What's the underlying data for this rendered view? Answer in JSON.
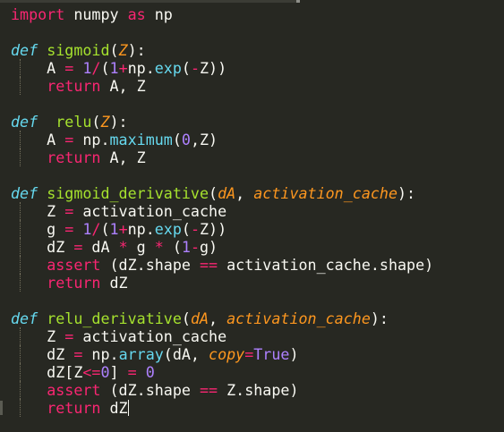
{
  "code": {
    "lines": [
      [
        {
          "t": "import",
          "c": "kw"
        },
        {
          "t": " numpy ",
          "c": "txt"
        },
        {
          "t": "as",
          "c": "kw"
        },
        {
          "t": " np",
          "c": "txt"
        }
      ],
      [],
      [
        {
          "t": "def",
          "c": "def"
        },
        {
          "t": " ",
          "c": "txt"
        },
        {
          "t": "sigmoid",
          "c": "fn"
        },
        {
          "t": "(",
          "c": "txt"
        },
        {
          "t": "Z",
          "c": "param"
        },
        {
          "t": "):",
          "c": "txt"
        }
      ],
      [
        {
          "t": "    A ",
          "c": "txt"
        },
        {
          "t": "=",
          "c": "op"
        },
        {
          "t": " ",
          "c": "txt"
        },
        {
          "t": "1",
          "c": "num"
        },
        {
          "t": "/",
          "c": "op"
        },
        {
          "t": "(",
          "c": "txt"
        },
        {
          "t": "1",
          "c": "num"
        },
        {
          "t": "+",
          "c": "op"
        },
        {
          "t": "np.",
          "c": "txt"
        },
        {
          "t": "exp",
          "c": "call"
        },
        {
          "t": "(",
          "c": "txt"
        },
        {
          "t": "-",
          "c": "op"
        },
        {
          "t": "Z))",
          "c": "txt"
        }
      ],
      [
        {
          "t": "    ",
          "c": "txt"
        },
        {
          "t": "return",
          "c": "kw"
        },
        {
          "t": " A, Z",
          "c": "txt"
        }
      ],
      [],
      [
        {
          "t": "def",
          "c": "def"
        },
        {
          "t": "  ",
          "c": "txt"
        },
        {
          "t": "relu",
          "c": "fn"
        },
        {
          "t": "(",
          "c": "txt"
        },
        {
          "t": "Z",
          "c": "param"
        },
        {
          "t": "):",
          "c": "txt"
        }
      ],
      [
        {
          "t": "    A ",
          "c": "txt"
        },
        {
          "t": "=",
          "c": "op"
        },
        {
          "t": " np.",
          "c": "txt"
        },
        {
          "t": "maximum",
          "c": "call"
        },
        {
          "t": "(",
          "c": "txt"
        },
        {
          "t": "0",
          "c": "num"
        },
        {
          "t": ",Z)",
          "c": "txt"
        }
      ],
      [
        {
          "t": "    ",
          "c": "txt"
        },
        {
          "t": "return",
          "c": "kw"
        },
        {
          "t": " A, Z",
          "c": "txt"
        }
      ],
      [],
      [
        {
          "t": "def",
          "c": "def"
        },
        {
          "t": " ",
          "c": "txt"
        },
        {
          "t": "sigmoid_derivative",
          "c": "fn"
        },
        {
          "t": "(",
          "c": "txt"
        },
        {
          "t": "dA",
          "c": "param"
        },
        {
          "t": ", ",
          "c": "txt"
        },
        {
          "t": "activation_cache",
          "c": "param"
        },
        {
          "t": "):",
          "c": "txt"
        }
      ],
      [
        {
          "t": "    Z ",
          "c": "txt"
        },
        {
          "t": "=",
          "c": "op"
        },
        {
          "t": " activation_cache",
          "c": "txt"
        }
      ],
      [
        {
          "t": "    g ",
          "c": "txt"
        },
        {
          "t": "=",
          "c": "op"
        },
        {
          "t": " ",
          "c": "txt"
        },
        {
          "t": "1",
          "c": "num"
        },
        {
          "t": "/",
          "c": "op"
        },
        {
          "t": "(",
          "c": "txt"
        },
        {
          "t": "1",
          "c": "num"
        },
        {
          "t": "+",
          "c": "op"
        },
        {
          "t": "np.",
          "c": "txt"
        },
        {
          "t": "exp",
          "c": "call"
        },
        {
          "t": "(",
          "c": "txt"
        },
        {
          "t": "-",
          "c": "op"
        },
        {
          "t": "Z))",
          "c": "txt"
        }
      ],
      [
        {
          "t": "    dZ ",
          "c": "txt"
        },
        {
          "t": "=",
          "c": "op"
        },
        {
          "t": " dA ",
          "c": "txt"
        },
        {
          "t": "*",
          "c": "op"
        },
        {
          "t": " g ",
          "c": "txt"
        },
        {
          "t": "*",
          "c": "op"
        },
        {
          "t": " (",
          "c": "txt"
        },
        {
          "t": "1",
          "c": "num"
        },
        {
          "t": "-",
          "c": "op"
        },
        {
          "t": "g)",
          "c": "txt"
        }
      ],
      [
        {
          "t": "    ",
          "c": "txt"
        },
        {
          "t": "assert",
          "c": "kw"
        },
        {
          "t": " (dZ.shape ",
          "c": "txt"
        },
        {
          "t": "==",
          "c": "op"
        },
        {
          "t": " activation_cache.shape)",
          "c": "txt"
        }
      ],
      [
        {
          "t": "    ",
          "c": "txt"
        },
        {
          "t": "return",
          "c": "kw"
        },
        {
          "t": " dZ",
          "c": "txt"
        }
      ],
      [],
      [
        {
          "t": "def",
          "c": "def"
        },
        {
          "t": " ",
          "c": "txt"
        },
        {
          "t": "relu_derivative",
          "c": "fn"
        },
        {
          "t": "(",
          "c": "txt"
        },
        {
          "t": "dA",
          "c": "param"
        },
        {
          "t": ", ",
          "c": "txt"
        },
        {
          "t": "activation_cache",
          "c": "param"
        },
        {
          "t": "):",
          "c": "txt"
        }
      ],
      [
        {
          "t": "    Z ",
          "c": "txt"
        },
        {
          "t": "=",
          "c": "op"
        },
        {
          "t": " activation_cache",
          "c": "txt"
        }
      ],
      [
        {
          "t": "    dZ ",
          "c": "txt"
        },
        {
          "t": "=",
          "c": "op"
        },
        {
          "t": " np.",
          "c": "txt"
        },
        {
          "t": "array",
          "c": "call"
        },
        {
          "t": "(dA, ",
          "c": "txt"
        },
        {
          "t": "copy",
          "c": "param"
        },
        {
          "t": "=",
          "c": "op"
        },
        {
          "t": "True",
          "c": "const"
        },
        {
          "t": ")",
          "c": "txt"
        }
      ],
      [
        {
          "t": "    dZ[Z",
          "c": "txt"
        },
        {
          "t": "<=",
          "c": "op"
        },
        {
          "t": "0",
          "c": "num"
        },
        {
          "t": "] ",
          "c": "txt"
        },
        {
          "t": "=",
          "c": "op"
        },
        {
          "t": " ",
          "c": "txt"
        },
        {
          "t": "0",
          "c": "num"
        }
      ],
      [
        {
          "t": "    ",
          "c": "txt"
        },
        {
          "t": "assert",
          "c": "kw"
        },
        {
          "t": " (dZ.shape ",
          "c": "txt"
        },
        {
          "t": "==",
          "c": "op"
        },
        {
          "t": " Z.shape)",
          "c": "txt"
        }
      ],
      [
        {
          "t": "    ",
          "c": "txt"
        },
        {
          "t": "return",
          "c": "kw"
        },
        {
          "t": " dZ",
          "c": "txt"
        }
      ]
    ],
    "cursor_line": 22,
    "indented_lines": [
      3,
      4,
      7,
      8,
      11,
      12,
      13,
      14,
      15,
      18,
      19,
      20,
      21,
      22
    ]
  }
}
